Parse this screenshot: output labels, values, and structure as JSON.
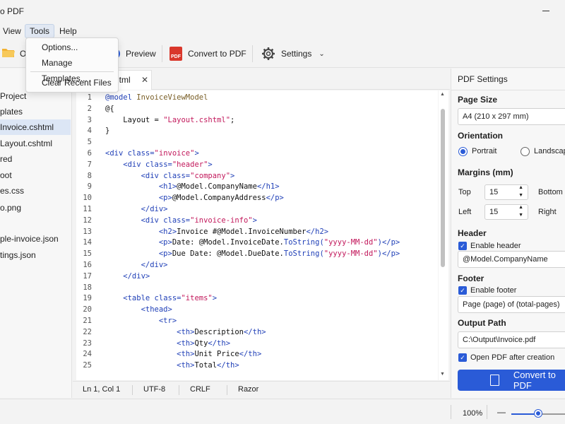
{
  "app": {
    "title_fragment": "o PDF"
  },
  "menu": {
    "view": "View",
    "tools": "Tools",
    "help": "Help"
  },
  "tools_menu": {
    "options": "Options...",
    "manage_templates": "Manage Templates...",
    "clear_recent": "Clear Recent Files"
  },
  "toolbar": {
    "open_fragment": "O",
    "preview": "Preview",
    "convert": "Convert to PDF",
    "settings": "Settings",
    "pdf_badge": "PDF"
  },
  "files": [
    {
      "label": "Project"
    },
    {
      "label": "plates"
    },
    {
      "label": "Invoice.cshtml"
    },
    {
      "label": "Layout.cshtml"
    },
    {
      "label": "red"
    },
    {
      "label": "oot"
    },
    {
      "label": "es.css"
    },
    {
      "label": "o.png"
    },
    {
      "label": ""
    },
    {
      "label": "ple-invoice.json"
    },
    {
      "label": "tings.json"
    }
  ],
  "editor_tab": {
    "label": "html",
    "close": "✕"
  },
  "code": {
    "line_numbers": [
      "1",
      "2",
      "3",
      "4",
      "5",
      "6",
      "7",
      "8",
      "9",
      "10",
      "11",
      "12",
      "13",
      "14",
      "15",
      "16",
      "17",
      "18",
      "19",
      "20",
      "21",
      "22",
      "23",
      "24",
      "25"
    ],
    "lines": [
      [
        "@model InvoiceViewModel"
      ],
      [
        "@{"
      ],
      [
        "    Layout = ",
        "\"Layout.cshtml\"",
        ";"
      ],
      [
        "}"
      ],
      [
        ""
      ],
      [
        "<div ",
        "class=",
        "\"invoice\"",
        ">"
      ],
      [
        "    <div ",
        "class=",
        "\"header\"",
        ">"
      ],
      [
        "        <div ",
        "class=",
        "\"company\"",
        ">"
      ],
      [
        "            <h1>",
        "@Model.CompanyName",
        "</h1>"
      ],
      [
        "            <p>",
        "@Model.CompanyAddress",
        "</p>"
      ],
      [
        "        </div>"
      ],
      [
        "        <div ",
        "class=",
        "\"invoice-info\"",
        ">"
      ],
      [
        "            <h2>",
        "Invoice #@Model.InvoiceNumber",
        "</h2>"
      ],
      [
        "            <p>",
        "Date: @Model.InvoiceDate.",
        "ToString",
        "(",
        "\"yyyy-MM-dd\"",
        ")",
        "</p>"
      ],
      [
        "            <p>",
        "Due Date: @Model.DueDate.",
        "ToString",
        "(",
        "\"yyyy-MM-dd\"",
        ")",
        "</p>"
      ],
      [
        "        </div>"
      ],
      [
        "    </div>"
      ],
      [
        ""
      ],
      [
        "    <table ",
        "class=",
        "\"items\"",
        ">"
      ],
      [
        "        <thead>"
      ],
      [
        "            <tr>"
      ],
      [
        "                <th>",
        "Description",
        "</th>"
      ],
      [
        "                <th>",
        "Qty",
        "</th>"
      ],
      [
        "                <th>",
        "Unit Price",
        "</th>"
      ],
      [
        "                <th>",
        "Total",
        "</th>"
      ]
    ]
  },
  "editor_status": {
    "position": "Ln 1, Col 1",
    "encoding": "UTF-8",
    "line_endings": "CRLF",
    "language": "Razor"
  },
  "panel": {
    "title": "PDF Settings",
    "page_size_label": "Page Size",
    "page_size_value": "A4 (210 x 297 mm)",
    "orientation_label": "Orientation",
    "portrait": "Portrait",
    "landscape": "Landscape",
    "margins_label": "Margins (mm)",
    "top_label": "Top",
    "top_value": "15",
    "bottom_label": "Bottom",
    "left_label": "Left",
    "left_value": "15",
    "right_label": "Right",
    "header_label": "Header",
    "enable_header": "Enable header",
    "header_value": "@Model.CompanyName",
    "footer_label": "Footer",
    "enable_footer": "Enable footer",
    "footer_value": "Page (page) of (total-pages)",
    "output_label": "Output Path",
    "output_value": "C:\\Output\\Invoice.pdf",
    "open_after": "Open PDF after creation",
    "convert_button": "Convert to PDF"
  },
  "status": {
    "zoom": "100%",
    "zoom_minus": "—",
    "zoom_fraction": 0.5
  },
  "colors": {
    "accent": "#2a5bd7",
    "selection": "#dce6f5",
    "pdf_red": "#d9372b"
  }
}
